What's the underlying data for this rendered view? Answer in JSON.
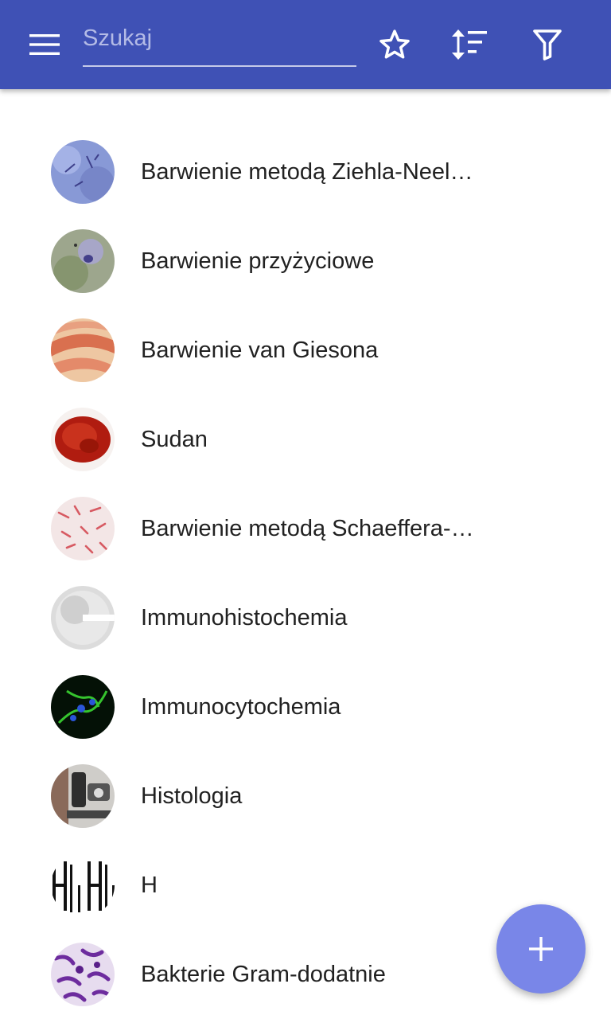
{
  "search": {
    "placeholder": "Szukaj",
    "value": ""
  },
  "toolbar": {
    "icons": [
      "menu-icon",
      "star-icon",
      "sort-icon",
      "filter-icon"
    ]
  },
  "items": [
    {
      "label": "Barwienie metodą Ziehla-Neelsena"
    },
    {
      "label": "Barwienie przyżyciowe"
    },
    {
      "label": "Barwienie van Giesona"
    },
    {
      "label": "Sudan"
    },
    {
      "label": "Barwienie metodą Schaeffera-Fultona"
    },
    {
      "label": "Immunohistochemia"
    },
    {
      "label": "Immunocytochemia"
    },
    {
      "label": "Histologia"
    },
    {
      "label": "H"
    },
    {
      "label": "Bakterie Gram-dodatnie"
    }
  ],
  "fab": {
    "icon": "plus-icon"
  },
  "colors": {
    "appbar": "#3f51b5",
    "fab": "#7986e8",
    "text": "#212121"
  }
}
